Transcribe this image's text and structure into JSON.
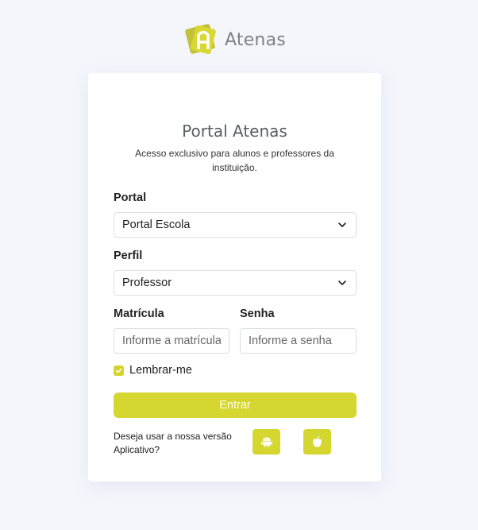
{
  "brand": {
    "name": "Atenas"
  },
  "card": {
    "title": "Portal Atenas",
    "subtitle": "Acesso exclusivo para alunos e professores da instituição."
  },
  "form": {
    "portal_label": "Portal",
    "portal_value": "Portal Escola",
    "perfil_label": "Perfil",
    "perfil_value": "Professor",
    "matricula_label": "Matrícula",
    "matricula_placeholder": "Informe a matrícula",
    "senha_label": "Senha",
    "senha_placeholder": "Informe a senha",
    "remember_label": "Lembrar-me",
    "remember_checked": true,
    "submit_label": "Entrar"
  },
  "app": {
    "prompt": "Deseja usar a nossa versão Aplicativo?",
    "buttons": [
      "android-icon",
      "apple-icon"
    ]
  },
  "colors": {
    "accent": "#d6d630",
    "background": "#f4f6fc",
    "logo_gray": "#7d8186"
  }
}
